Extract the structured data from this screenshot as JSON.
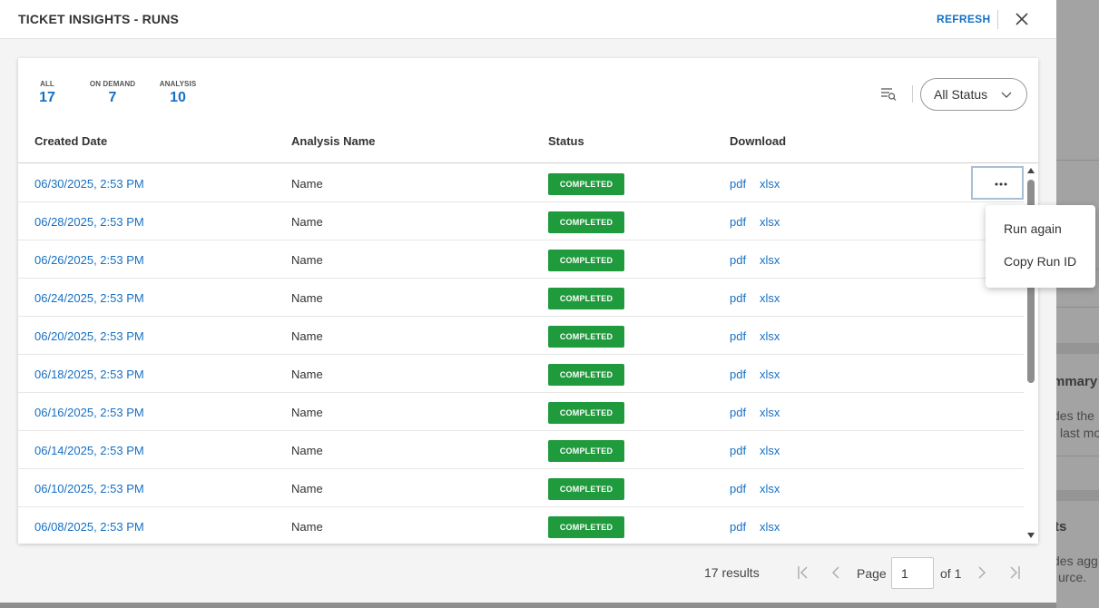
{
  "header": {
    "title": "TICKET INSIGHTS - RUNS",
    "refresh_label": "REFRESH"
  },
  "stats": [
    {
      "label": "ALL",
      "value": "17"
    },
    {
      "label": "ON DEMAND",
      "value": "7"
    },
    {
      "label": "ANALYSIS",
      "value": "10"
    }
  ],
  "status_filter": {
    "selected": "All Status"
  },
  "table": {
    "columns": [
      "Created Date",
      "Analysis Name",
      "Status",
      "Download"
    ],
    "rows": [
      {
        "date": "06/30/2025, 2:53 PM",
        "name": "Name",
        "status": "COMPLETED",
        "pdf": "pdf",
        "xlsx": "xlsx"
      },
      {
        "date": "06/28/2025, 2:53 PM",
        "name": "Name",
        "status": "COMPLETED",
        "pdf": "pdf",
        "xlsx": "xlsx"
      },
      {
        "date": "06/26/2025, 2:53 PM",
        "name": "Name",
        "status": "COMPLETED",
        "pdf": "pdf",
        "xlsx": "xlsx"
      },
      {
        "date": "06/24/2025, 2:53 PM",
        "name": "Name",
        "status": "COMPLETED",
        "pdf": "pdf",
        "xlsx": "xlsx"
      },
      {
        "date": "06/20/2025, 2:53 PM",
        "name": "Name",
        "status": "COMPLETED",
        "pdf": "pdf",
        "xlsx": "xlsx"
      },
      {
        "date": "06/18/2025, 2:53 PM",
        "name": "Name",
        "status": "COMPLETED",
        "pdf": "pdf",
        "xlsx": "xlsx"
      },
      {
        "date": "06/16/2025, 2:53 PM",
        "name": "Name",
        "status": "COMPLETED",
        "pdf": "pdf",
        "xlsx": "xlsx"
      },
      {
        "date": "06/14/2025, 2:53 PM",
        "name": "Name",
        "status": "COMPLETED",
        "pdf": "pdf",
        "xlsx": "xlsx"
      },
      {
        "date": "06/10/2025, 2:53 PM",
        "name": "Name",
        "status": "COMPLETED",
        "pdf": "pdf",
        "xlsx": "xlsx"
      },
      {
        "date": "06/08/2025, 2:53 PM",
        "name": "Name",
        "status": "COMPLETED",
        "pdf": "pdf",
        "xlsx": "xlsx"
      }
    ]
  },
  "row_menu": {
    "items": [
      "Run again",
      "Copy Run ID"
    ]
  },
  "pagination": {
    "results_text": "17 results",
    "page_label": "Page",
    "page_value": "1",
    "of_text": "of 1"
  },
  "background": {
    "texts": [
      "mmary",
      "des the",
      "last mo",
      "ts",
      "des agg",
      "urce."
    ]
  },
  "icons": {
    "close": "close-icon",
    "filter": "filter-list-icon",
    "more": "more-horizontal-icon",
    "first": "first-page-icon",
    "prev": "prev-page-icon",
    "next": "next-page-icon",
    "last": "last-page-icon"
  },
  "colors": {
    "accent": "#1670c4",
    "status_completed": "#1f9a3c"
  }
}
